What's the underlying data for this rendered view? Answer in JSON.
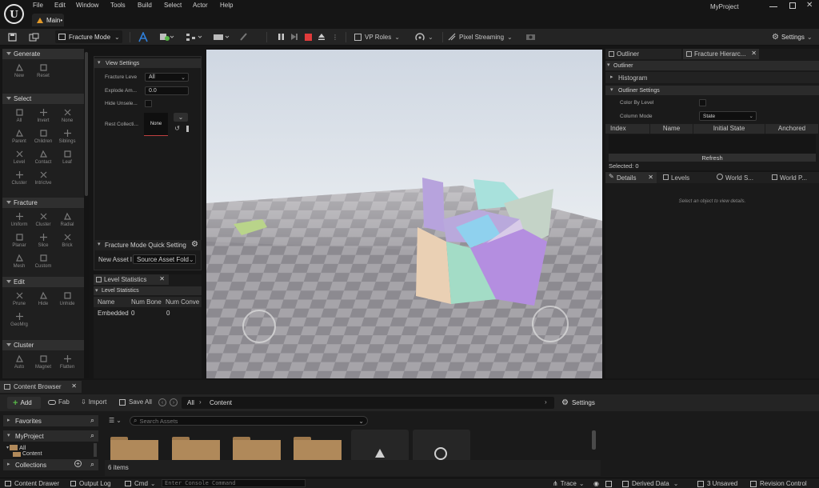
{
  "app": {
    "menu": [
      "File",
      "Edit",
      "Window",
      "Tools",
      "Build",
      "Select",
      "Actor",
      "Help"
    ],
    "project_name": "MyProject",
    "document_tab": "Main•"
  },
  "toolbar": {
    "mode": "Fracture Mode",
    "vp_roles": "VP Roles",
    "pixel_streaming": "Pixel Streaming",
    "settings": "Settings"
  },
  "palette": {
    "categories": [
      {
        "label": "Generate",
        "tools": [
          "New",
          "Reset"
        ]
      },
      {
        "label": "Select",
        "tools": [
          "All",
          "Invert",
          "None",
          "Parent",
          "Children",
          "Siblings",
          "Level",
          "Contact",
          "Leaf",
          "Cluster",
          "Intrictve"
        ]
      },
      {
        "label": "Fracture",
        "tools": [
          "Uniform",
          "Cluster",
          "Radial",
          "Planar",
          "Slice",
          "Brick",
          "Mesh",
          "Custom"
        ]
      },
      {
        "label": "Edit",
        "tools": [
          "Prune",
          "Hide",
          "Unhide",
          "GeoMrg"
        ]
      },
      {
        "label": "Cluster",
        "tools": [
          "Auto",
          "Magnet",
          "Flatten"
        ]
      }
    ]
  },
  "view_settings": {
    "header": "View Settings",
    "fracture_level_label": "Fracture Leve",
    "fracture_level_value": "All",
    "explode_label": "Explode Am...",
    "explode_value": "0.0",
    "hide_label": "Hide Unsele...",
    "rest_label": "Rest Collecti...",
    "rest_value": "None",
    "quick_settings": "Fracture Mode Quick Setting",
    "new_asset_label": "New Asset l",
    "new_asset_value": "Source Asset Fold"
  },
  "level_stats": {
    "tab": "Level Statistics",
    "header": "Level Statistics",
    "columns": [
      "Name",
      "Num Bone",
      "Num Conve"
    ],
    "rows": [
      [
        "Embedded",
        "0",
        "0"
      ]
    ]
  },
  "outliner_panel": {
    "tab_outliner": "Outliner",
    "tab_fracture": "Fracture Hierarc...",
    "section_outliner": "Outliner",
    "histogram": "Histogram",
    "outliner_settings": "Outliner Settings",
    "color_by_level": "Color By Level",
    "column_mode_label": "Column Mode",
    "column_mode_value": "State",
    "columns": [
      "Index",
      "Name",
      "Initial State",
      "Anchored"
    ],
    "refresh": "Refresh",
    "selected": "Selected: 0"
  },
  "details_panel": {
    "tabs": [
      "Details",
      "Levels",
      "World S...",
      "World P..."
    ],
    "empty_message": "Select an object to view details."
  },
  "content_browser": {
    "tab": "Content Browser",
    "add": "Add",
    "fab": "Fab",
    "import": "Import",
    "save_all": "Save All",
    "path_all": "All",
    "path_content": "Content",
    "settings": "Settings",
    "favorites": "Favorites",
    "project": "MyProject",
    "tree_all": "All",
    "tree_content": "Content",
    "collections": "Collections",
    "search_placeholder": "Search Assets",
    "item_count": "6 items"
  },
  "statusbar": {
    "content_drawer": "Content Drawer",
    "output_log": "Output Log",
    "cmd": "Cmd",
    "console_placeholder": "Enter Console Command",
    "trace": "Trace",
    "derived_data": "Derived Data",
    "unsaved": "3 Unsaved",
    "revision_control": "Revision Control"
  },
  "colors": {
    "accent_blue": "#2f7fd9",
    "stop_red": "#e03b3b",
    "add_green": "#58b648",
    "panel_bg": "#1a1a1a",
    "sky": "#dfe5ec",
    "folder": "#b0895a"
  }
}
